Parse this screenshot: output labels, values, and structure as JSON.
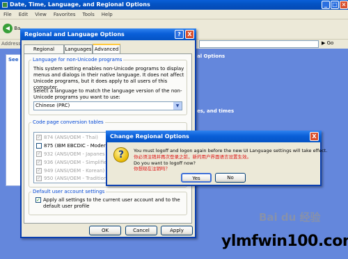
{
  "back_window": {
    "title": "Date, Time, Language, and Regional Options",
    "menu": [
      "File",
      "Edit",
      "View",
      "Favorites",
      "Tools",
      "Help"
    ],
    "back_label": "Ba",
    "address_label": "Address",
    "go_label": "Go",
    "left_pane_label": "See",
    "right_text_1": "al Options",
    "right_text_2": "es, and times"
  },
  "dialog": {
    "title": "Regional and Language Options",
    "help_button": "?",
    "close_button": "X",
    "tabs": [
      {
        "label": "Regional Options",
        "active": false
      },
      {
        "label": "Languages",
        "active": false
      },
      {
        "label": "Advanced",
        "active": true
      }
    ],
    "non_unicode": {
      "legend": "Language for non-Unicode programs",
      "description": "This system setting enables non-Unicode programs to display menus and dialogs in their native language. It does not affect Unicode programs, but it does apply to all users of this computer.",
      "select_prompt": "Select a language to match the language version of the non-Unicode programs you want to use:",
      "selected_language": "Chinese (PRC)"
    },
    "code_pages": {
      "legend": "Code page conversion tables",
      "items": [
        {
          "label": "874  (ANSI/OEM - Thai)",
          "checked": true,
          "enabled": false
        },
        {
          "label": "875  (IBM EBCDIC - Modern",
          "checked": false,
          "enabled": true
        },
        {
          "label": "932  (ANSI/OEM - Japanes",
          "checked": true,
          "enabled": false
        },
        {
          "label": "936  (ANSI/OEM - Simplified",
          "checked": true,
          "enabled": false
        },
        {
          "label": "949  (ANSI/OEM - Korean)",
          "checked": true,
          "enabled": false
        },
        {
          "label": "950  (ANSI/OEM - Tradition",
          "checked": true,
          "enabled": false
        }
      ]
    },
    "default_user": {
      "legend": "Default user account settings",
      "apply_label": "Apply all settings to the current user account and to the default user profile",
      "checked": true
    },
    "buttons": {
      "ok": "OK",
      "cancel": "Cancel",
      "apply": "Apply"
    }
  },
  "popup": {
    "title": "Change Regional Options",
    "close_button": "X",
    "icon": "question-icon",
    "message_en": "You must logoff and logon again before the new UI Language settings will take effect.",
    "message_cn": "你必须注销并再次登录之前，新的用户界面语言设置生效。",
    "question_en": "Do you want to logoff now?",
    "question_cn": "你想现在注销吗？",
    "yes_label": "Yes",
    "no_label": "No"
  },
  "watermark": {
    "baidu": "Bai du 经验",
    "site": "ylmfwin100.com"
  }
}
